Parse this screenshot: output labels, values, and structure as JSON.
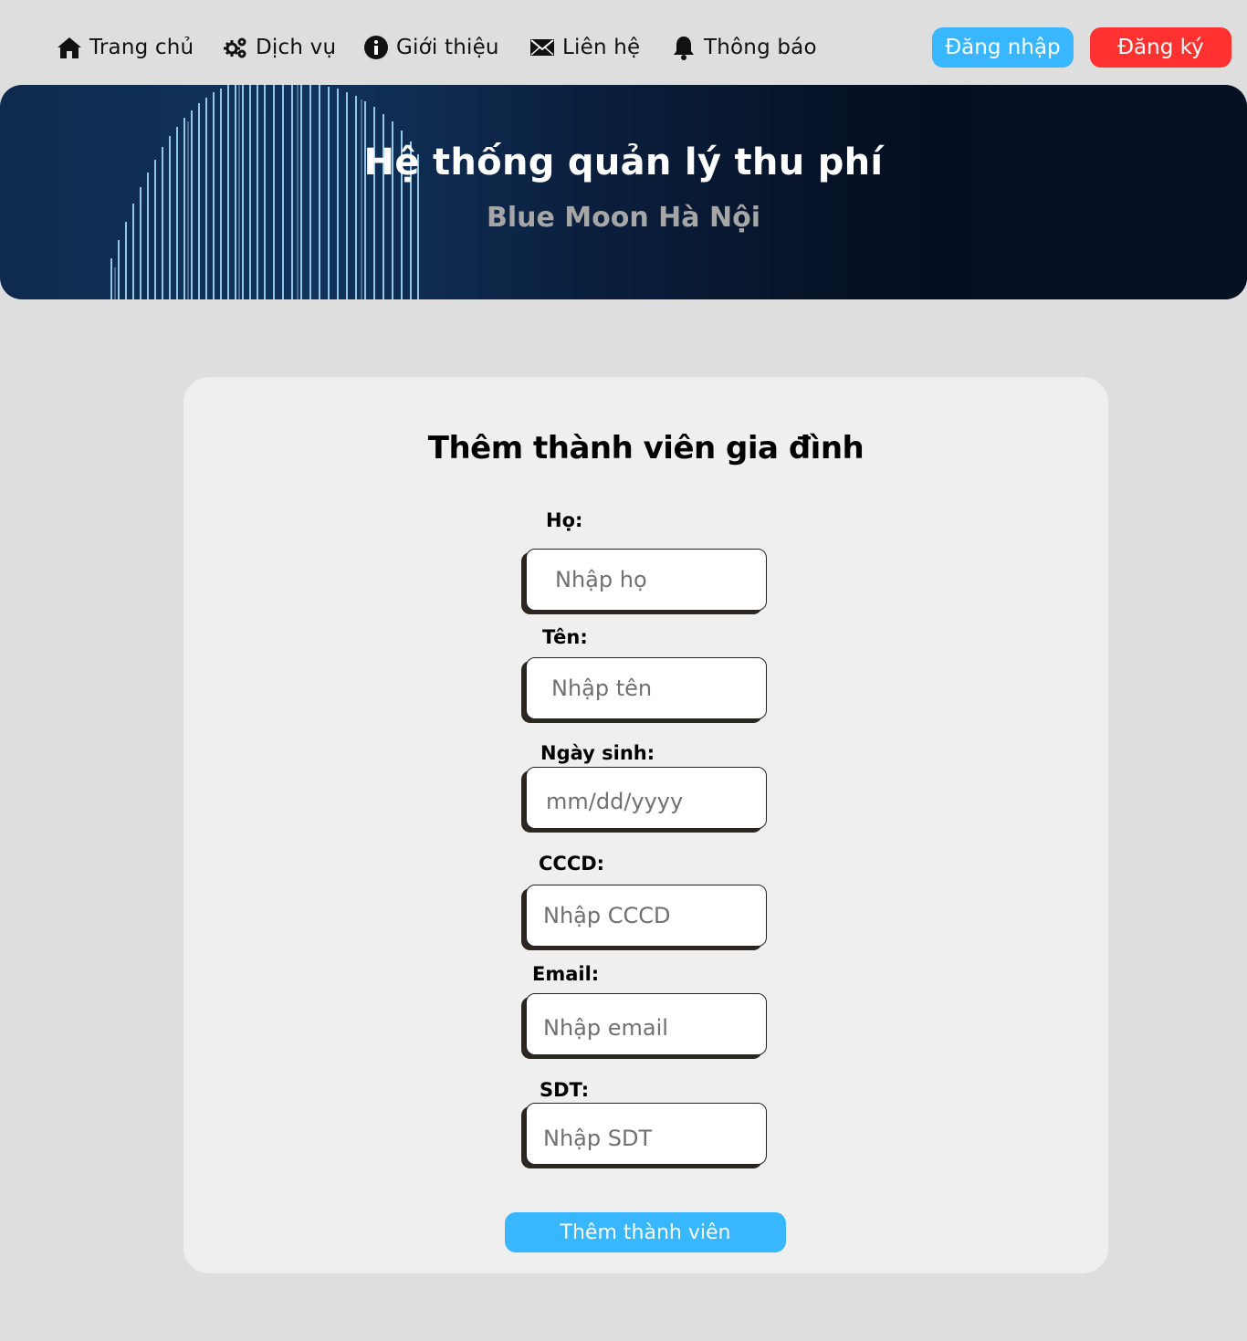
{
  "nav": {
    "items": [
      {
        "label": "Trang chủ",
        "icon": "home-icon"
      },
      {
        "label": "Dịch vụ",
        "icon": "gears-icon"
      },
      {
        "label": "Giới thiệu",
        "icon": "info-icon"
      },
      {
        "label": "Liên hệ",
        "icon": "mail-icon"
      },
      {
        "label": "Thông báo",
        "icon": "bell-icon"
      }
    ],
    "login_label": "Đăng nhập",
    "register_label": "Đăng ký"
  },
  "hero": {
    "title": "Hệ thống quản lý thu phí",
    "subtitle": "Blue Moon Hà Nội"
  },
  "form": {
    "title": "Thêm thành viên gia đình",
    "fields": [
      {
        "label": "Họ:",
        "placeholder": "Nhập họ"
      },
      {
        "label": "Tên:",
        "placeholder": "Nhập tên"
      },
      {
        "label": "Ngày sinh:",
        "placeholder": "mm/dd/yyyy"
      },
      {
        "label": "CCCD:",
        "placeholder": "Nhập CCCD"
      },
      {
        "label": "Email:",
        "placeholder": "Nhập email"
      },
      {
        "label": "SDT:",
        "placeholder": "Nhập SDT"
      }
    ],
    "submit_label": "Thêm thành viên"
  },
  "colors": {
    "accent": "#38b6ff",
    "danger": "#ff3131",
    "page_bg": "#dedede",
    "card_bg": "#efefef"
  }
}
